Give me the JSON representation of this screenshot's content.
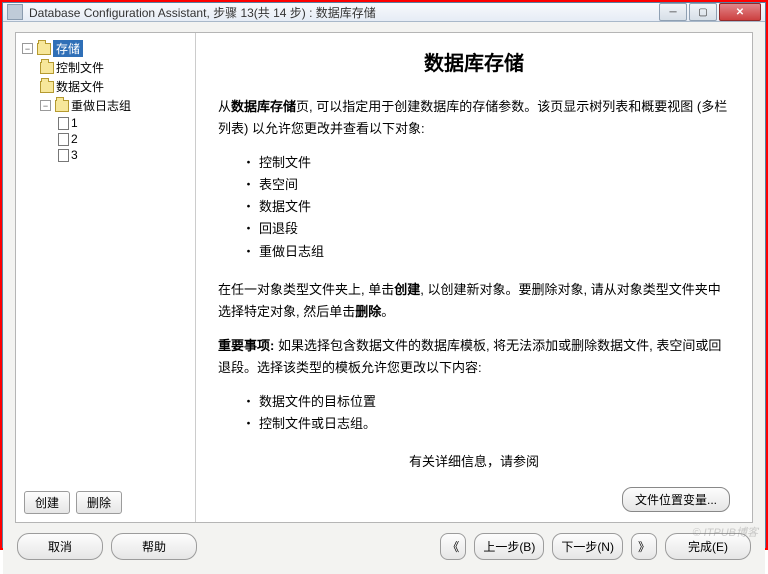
{
  "titlebar": {
    "title": "Database Configuration Assistant, 步骤 13(共 14 步) : 数据库存储"
  },
  "tree": {
    "root": "存储",
    "items": {
      "control_files": "控制文件",
      "data_files": "数据文件",
      "redo_group": "重做日志组",
      "redo_children": [
        "1",
        "2",
        "3"
      ]
    }
  },
  "tree_buttons": {
    "create": "创建",
    "delete": "删除"
  },
  "content": {
    "heading": "数据库存储",
    "intro_1": "从",
    "intro_bold": "数据库存储",
    "intro_2": "页, 可以指定用于创建数据库的存储参数。该页显示树列表和概要视图 (多栏列表) 以允许您更改并查看以下对象:",
    "list1": [
      "控制文件",
      "表空间",
      "数据文件",
      "回退段",
      "重做日志组"
    ],
    "para2_1": "在任一对象类型文件夹上, 单击",
    "para2_bold1": "创建",
    "para2_2": ", 以创建新对象。要删除对象, 请从对象类型文件夹中选择特定对象, 然后单击",
    "para2_bold2": "删除",
    "para2_3": "。",
    "important_label": "重要事项:",
    "important_text": " 如果选择包含数据文件的数据库模板, 将无法添加或删除数据文件, 表空间或回退段。选择该类型的模板允许您更改以下内容:",
    "list2": [
      "数据文件的目标位置",
      "控制文件或日志组。"
    ],
    "more_info": "有关详细信息，请参阅"
  },
  "loc_button": "文件位置变量...",
  "footer": {
    "cancel": "取消",
    "help": "帮助",
    "back": "上一步(B)",
    "next": "下一步(N)",
    "finish": "完成(E)"
  },
  "watermark": "© ITPUB博客"
}
